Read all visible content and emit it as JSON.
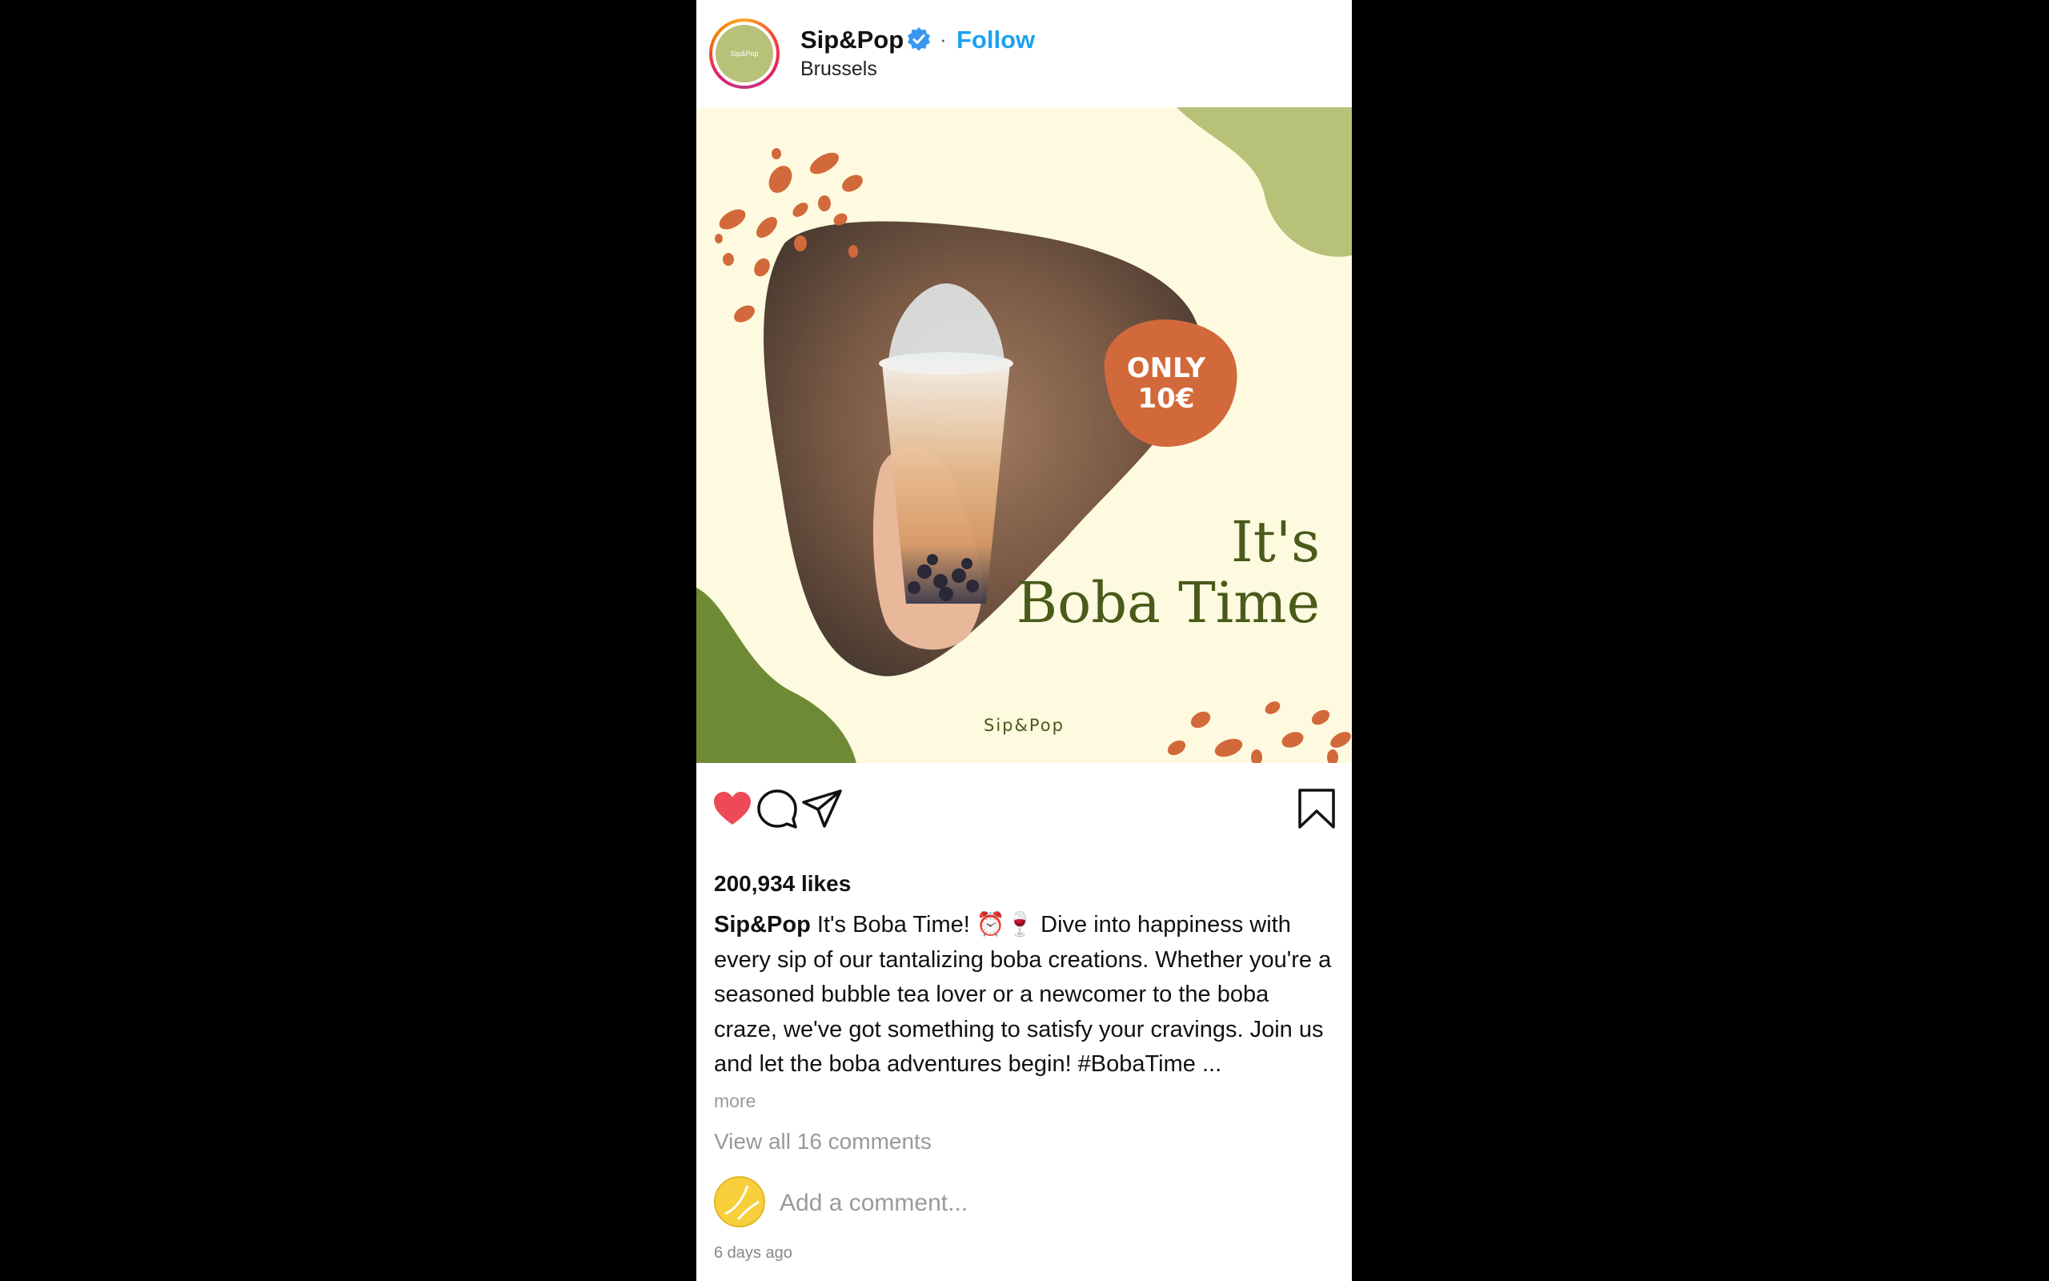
{
  "header": {
    "username": "Sip&Pop",
    "separator": "·",
    "follow_label": "Follow",
    "location": "Brussels",
    "avatar_text": "Sip&Pop"
  },
  "image": {
    "badge_line1": "ONLY",
    "badge_line2": "10€",
    "headline_line1": "It's",
    "headline_line2": "Boba Time",
    "watermark": "Sip&Pop"
  },
  "post": {
    "likes": "200,934 likes",
    "caption_user": "Sip&Pop",
    "caption_text": " It's Boba Time! ⏰🍷 Dive into happiness with every sip of our tantalizing boba creations. Whether you're a seasoned bubble tea lover or a newcomer to the boba craze, we've got something to satisfy your cravings. Join us and let the boba adventures begin! #BobaTime ...",
    "more_label": "more",
    "view_comments": "View all 16 comments",
    "comment_placeholder": "Add a comment...",
    "timestamp": "6 days ago"
  },
  "icons": {
    "verified": "verified-badge-icon",
    "like": "heart-icon",
    "comment": "comment-bubble-icon",
    "share": "paper-plane-icon",
    "save": "bookmark-icon"
  },
  "colors": {
    "follow": "#1da1f2",
    "heart": "#ed4956",
    "image_background": "#fdfae0",
    "accent_orange": "#d2693a",
    "accent_green": "#b7c178",
    "headline_green": "#4a5a1a"
  }
}
